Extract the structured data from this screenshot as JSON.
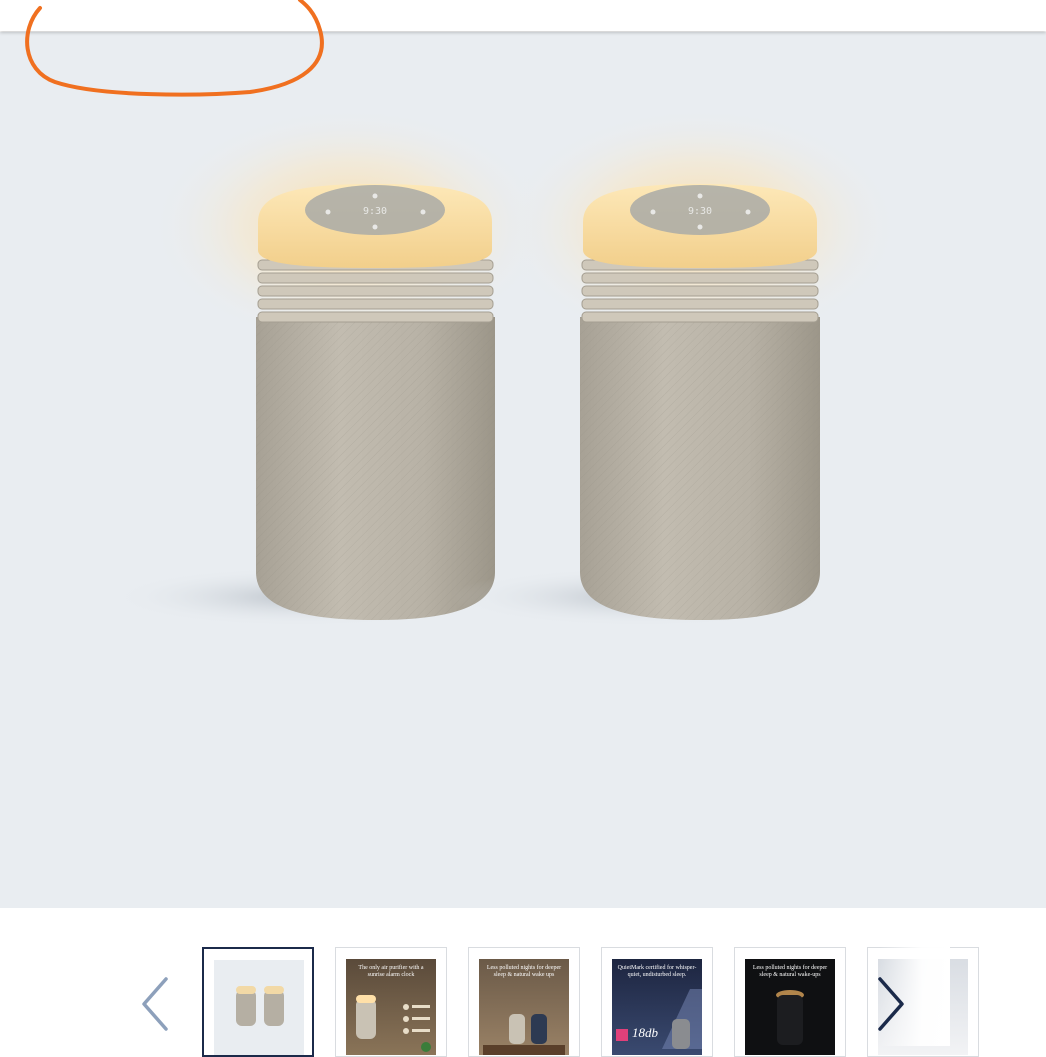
{
  "gallery": {
    "main_image_alt": "Two beige fabric air purifiers with glowing sunrise light tops",
    "clock_time": "9:30",
    "prev_icon": "chevron-left-icon",
    "next_icon": "chevron-right-icon",
    "thumbnails": [
      {
        "caption": "",
        "active": true
      },
      {
        "caption": "The only air purifier with a sunrise alarm clock",
        "active": false
      },
      {
        "caption": "Less polluted nights for deeper sleep & natural wake ups",
        "active": false
      },
      {
        "caption": "QuietMark certified for whisper-quiet, undisturbed sleep.",
        "badge": "18db",
        "active": false
      },
      {
        "caption": "Less polluted nights for deeper sleep & natural wake-ups",
        "active": false
      },
      {
        "caption": "",
        "active": false
      }
    ]
  },
  "colors": {
    "annotation": "#f07020",
    "hero_bg": "#e9edf1",
    "active_border": "#1b2a4a",
    "chevron_inactive": "#8da0bb",
    "chevron_active": "#1b2a4a"
  }
}
